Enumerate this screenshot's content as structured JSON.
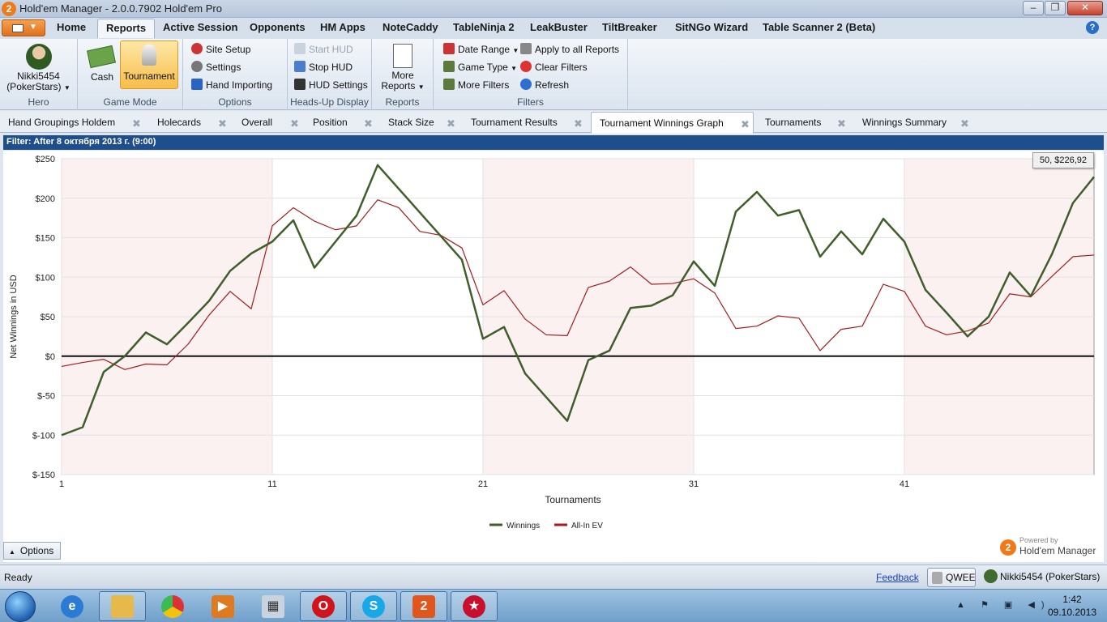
{
  "window": {
    "title": "Hold'em Manager - 2.0.0.7902 Hold'em Pro"
  },
  "menu": {
    "tabs": [
      "Home",
      "Reports",
      "Active Session",
      "Opponents",
      "HM Apps",
      "NoteCaddy",
      "TableNinja 2",
      "LeakBuster",
      "TiltBreaker",
      "SitNGo Wizard",
      "Table Scanner 2 (Beta)"
    ],
    "active": "Reports"
  },
  "ribbon": {
    "hero": {
      "name": "Nikki5454",
      "site": "(PokerStars)",
      "label": "Hero"
    },
    "game_mode": {
      "cash": "Cash",
      "tournament": "Tournament",
      "label": "Game Mode"
    },
    "options": {
      "site_setup": "Site Setup",
      "settings": "Settings",
      "hand_importing": "Hand Importing",
      "label": "Options"
    },
    "hud": {
      "start": "Start HUD",
      "stop": "Stop HUD",
      "settings": "HUD Settings",
      "label": "Heads-Up Display"
    },
    "reports": {
      "more": "More",
      "more2": "Reports",
      "label": "Reports"
    },
    "filters": {
      "date_range": "Date Range",
      "game_type": "Game Type",
      "more_filters": "More Filters",
      "apply_all": "Apply to all Reports",
      "clear": "Clear Filters",
      "refresh": "Refresh",
      "label": "Filters"
    }
  },
  "report_tabs": [
    "Hand Groupings Holdem",
    "Holecards",
    "Overall",
    "Position",
    "Stack Size",
    "Tournament Results",
    "Tournament Winnings Graph",
    "Tournaments",
    "Winnings Summary"
  ],
  "active_report_tab": "Tournament Winnings Graph",
  "filter_text": "Filter: After 8 октября 2013 г. (9:00)",
  "tooltip": "50, $226,92",
  "options_label": "Options",
  "logo": {
    "powered_by": "Powered by",
    "name": "Hold'em Manager"
  },
  "chart_data": {
    "type": "line",
    "xlabel": "Tournaments",
    "ylabel": "Net Winnings in USD",
    "xlim": [
      1,
      50
    ],
    "ylim": [
      -150,
      250
    ],
    "x_ticks": [
      1,
      11,
      21,
      31,
      41
    ],
    "y_ticks": [
      250,
      200,
      150,
      100,
      50,
      0,
      -50,
      -100,
      -150
    ],
    "y_tick_labels": [
      "$250",
      "$200",
      "$150",
      "$100",
      "$50",
      "$0",
      "$-50",
      "$-100",
      "$-150"
    ],
    "grid": true,
    "legend": "bottom-center",
    "x": [
      1,
      2,
      3,
      4,
      5,
      6,
      7,
      8,
      9,
      10,
      11,
      12,
      13,
      14,
      15,
      16,
      17,
      18,
      19,
      20,
      21,
      22,
      23,
      24,
      25,
      26,
      27,
      28,
      29,
      30,
      31,
      32,
      33,
      34,
      35,
      36,
      37,
      38,
      39,
      40,
      41,
      42,
      43,
      44,
      45,
      46,
      47,
      48,
      49,
      50
    ],
    "series": [
      {
        "name": "Winnings",
        "color": "#3f5e2a",
        "values": [
          -100,
          -90,
          -20,
          0,
          30,
          15,
          42,
          70,
          108,
          130,
          145,
          172,
          112,
          145,
          178,
          242,
          212,
          182,
          152,
          122,
          22,
          37,
          -22,
          -52,
          -82,
          -5,
          7,
          61,
          64,
          77,
          120,
          89,
          183,
          208,
          178,
          185,
          126,
          158,
          129,
          174,
          145,
          84,
          55,
          25,
          50,
          106,
          76,
          129,
          194,
          227
        ]
      },
      {
        "name": "All-In EV",
        "color": "#a51c1c",
        "values": [
          -13,
          -8,
          -4,
          -17,
          -10,
          -11,
          15,
          52,
          82,
          60,
          165,
          188,
          171,
          160,
          165,
          198,
          188,
          158,
          153,
          137,
          65,
          83,
          47,
          27,
          26,
          87,
          95,
          113,
          91,
          92,
          98,
          80,
          35,
          38,
          51,
          48,
          7,
          34,
          38,
          91,
          82,
          38,
          27,
          32,
          42,
          79,
          75,
          101,
          126,
          128
        ]
      }
    ]
  },
  "status": {
    "text": "Ready",
    "feedback": "Feedback",
    "db": "QWEE",
    "player": "Nikki5454 (PokerStars)"
  },
  "taskbar": {
    "time": "1:42",
    "date": "09.10.2013"
  }
}
